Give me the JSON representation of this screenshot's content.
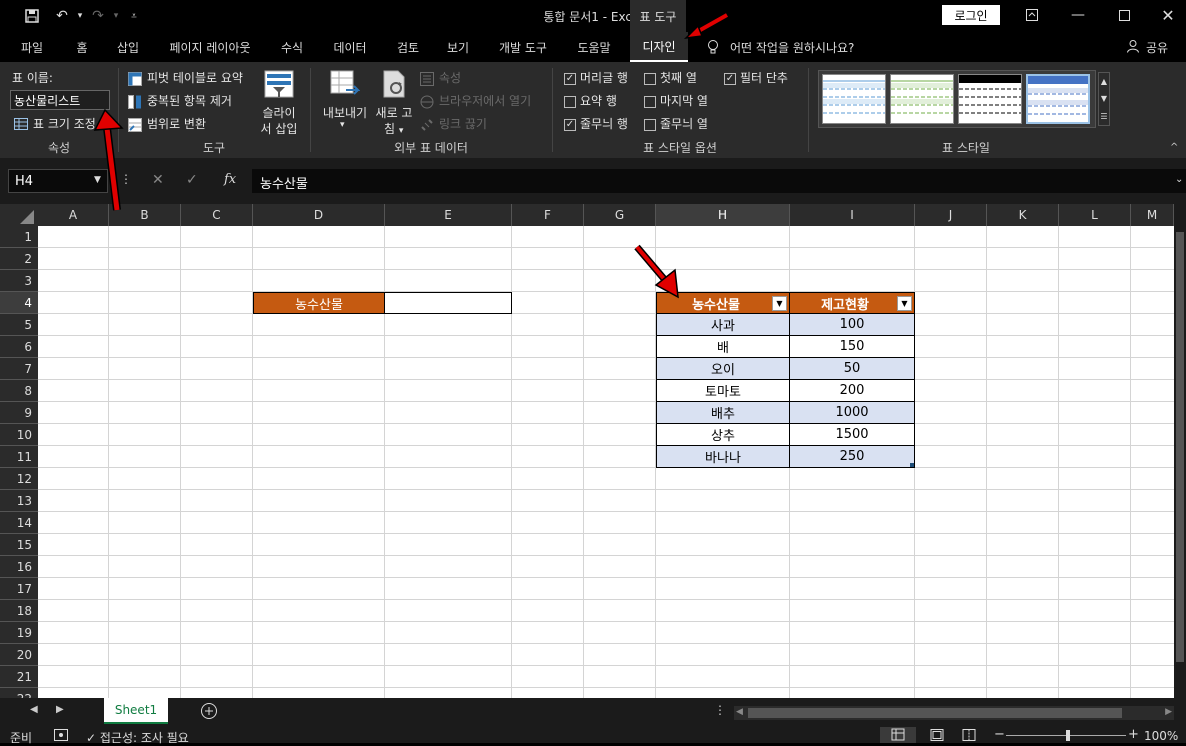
{
  "titlebar": {
    "title": "통합 문서1  -  Excel",
    "context_group": "표 도구",
    "login_label": "로그인",
    "save_icon": "save-icon",
    "undo_icon": "undo-icon",
    "redo_icon": "redo-icon"
  },
  "tabs": [
    "파일",
    "홈",
    "삽입",
    "페이지 레이아웃",
    "수식",
    "데이터",
    "검토",
    "보기",
    "개발 도구",
    "도움말",
    "디자인"
  ],
  "tell_me": "어떤 작업을 원하시나요?",
  "share_label": "공유",
  "ribbon": {
    "properties": {
      "table_name_label": "표 이름:",
      "table_name_value": "농산물리스트",
      "resize_label": "표 크기 조정",
      "group_label": "속성"
    },
    "tools": {
      "pivot_label": "피벗 테이블로 요약",
      "remove_dup_label": "중복된 항목 제거",
      "convert_range_label": "범위로 변환",
      "slicer_label_1": "슬라이",
      "slicer_label_2": "서 삽입",
      "group_label": "도구"
    },
    "external": {
      "export_label": "내보내기",
      "refresh_label_1": "새로 고",
      "refresh_label_2": "침",
      "properties_label": "속성",
      "open_browser_label": "브라우저에서 열기",
      "unlink_label": "링크 끊기",
      "group_label": "외부 표 데이터"
    },
    "style_options": {
      "header_row": "머리글 행",
      "total_row": "요약 행",
      "banded_rows": "줄무늬 행",
      "first_column": "첫째 열",
      "last_column": "마지막 열",
      "banded_columns": "줄무늬 열",
      "filter_button": "필터 단추",
      "group_label": "표 스타일 옵션"
    },
    "styles": {
      "group_label": "표 스타일"
    }
  },
  "formula_bar": {
    "name_box": "H4",
    "fx": "fx",
    "formula": "농수산물"
  },
  "columns": [
    "A",
    "B",
    "C",
    "D",
    "E",
    "F",
    "G",
    "H",
    "I",
    "J",
    "K",
    "L",
    "M"
  ],
  "rows": [
    "1",
    "2",
    "3",
    "4",
    "5",
    "6",
    "7",
    "8",
    "9",
    "10",
    "11",
    "12",
    "13",
    "14",
    "15",
    "16",
    "17",
    "18",
    "19",
    "20",
    "21",
    "22"
  ],
  "cells": {
    "d4": "농수산물",
    "e4": ""
  },
  "table": {
    "headers": [
      "농수산물",
      "제고현황"
    ],
    "rows": [
      [
        "사과",
        "100"
      ],
      [
        "배",
        "150"
      ],
      [
        "오이",
        "50"
      ],
      [
        "토마토",
        "200"
      ],
      [
        "배추",
        "1000"
      ],
      [
        "상추",
        "1500"
      ],
      [
        "바나나",
        "250"
      ]
    ]
  },
  "sheets": {
    "active": "Sheet1"
  },
  "status": {
    "ready": "준비",
    "accessibility": "접근성: 조사 필요",
    "zoom": "100%"
  },
  "colors": {
    "header_fill": "#c55a11",
    "band_fill": "#d9e1f2",
    "arrow": "#e00000"
  }
}
